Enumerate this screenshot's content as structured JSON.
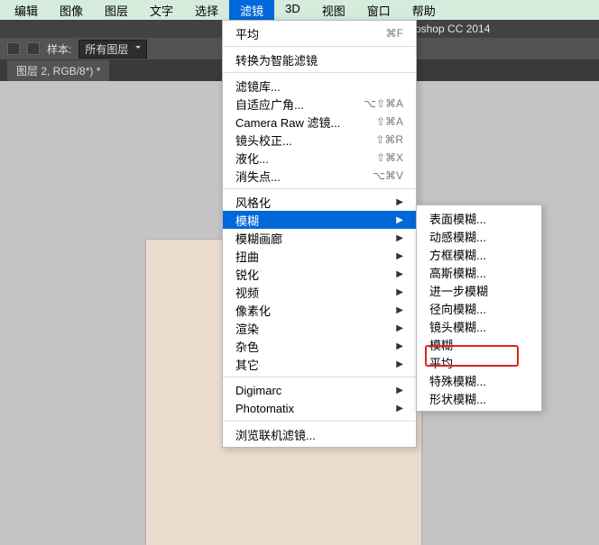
{
  "menubar": [
    "编辑",
    "图像",
    "图层",
    "文字",
    "选择",
    "滤镜",
    "3D",
    "视图",
    "窗口",
    "帮助"
  ],
  "menubar_active_index": 5,
  "app_title": "oshop CC 2014",
  "toolbar": {
    "sample_label": "样本:",
    "sample_value": "所有图层"
  },
  "doc_tab": "图层 2, RGB/8*) *",
  "filter_menu": [
    {
      "type": "item",
      "label": "平均",
      "shortcut": "⌘F"
    },
    {
      "type": "sep"
    },
    {
      "type": "item",
      "label": "转换为智能滤镜"
    },
    {
      "type": "sep"
    },
    {
      "type": "item",
      "label": "滤镜库..."
    },
    {
      "type": "item",
      "label": "自适应广角...",
      "shortcut": "⌥⇧⌘A"
    },
    {
      "type": "item",
      "label": "Camera Raw 滤镜...",
      "shortcut": "⇧⌘A"
    },
    {
      "type": "item",
      "label": "镜头校正...",
      "shortcut": "⇧⌘R"
    },
    {
      "type": "item",
      "label": "液化...",
      "shortcut": "⇧⌘X"
    },
    {
      "type": "item",
      "label": "消失点...",
      "shortcut": "⌥⌘V"
    },
    {
      "type": "sep"
    },
    {
      "type": "submenu",
      "label": "风格化"
    },
    {
      "type": "submenu",
      "label": "模糊",
      "selected": true
    },
    {
      "type": "submenu",
      "label": "模糊画廊"
    },
    {
      "type": "submenu",
      "label": "扭曲"
    },
    {
      "type": "submenu",
      "label": "锐化"
    },
    {
      "type": "submenu",
      "label": "视频"
    },
    {
      "type": "submenu",
      "label": "像素化"
    },
    {
      "type": "submenu",
      "label": "渲染"
    },
    {
      "type": "submenu",
      "label": "杂色"
    },
    {
      "type": "submenu",
      "label": "其它"
    },
    {
      "type": "sep"
    },
    {
      "type": "submenu",
      "label": "Digimarc"
    },
    {
      "type": "submenu",
      "label": "Photomatix"
    },
    {
      "type": "sep"
    },
    {
      "type": "item",
      "label": "浏览联机滤镜..."
    }
  ],
  "blur_submenu": [
    {
      "type": "item",
      "label": "表面模糊..."
    },
    {
      "type": "item",
      "label": "动感模糊..."
    },
    {
      "type": "item",
      "label": "方框模糊..."
    },
    {
      "type": "item",
      "label": "高斯模糊..."
    },
    {
      "type": "item",
      "label": "进一步模糊"
    },
    {
      "type": "item",
      "label": "径向模糊..."
    },
    {
      "type": "item",
      "label": "镜头模糊..."
    },
    {
      "type": "item",
      "label": "模糊"
    },
    {
      "type": "item",
      "label": "平均"
    },
    {
      "type": "item",
      "label": "特殊模糊..."
    },
    {
      "type": "item",
      "label": "形状模糊..."
    }
  ]
}
